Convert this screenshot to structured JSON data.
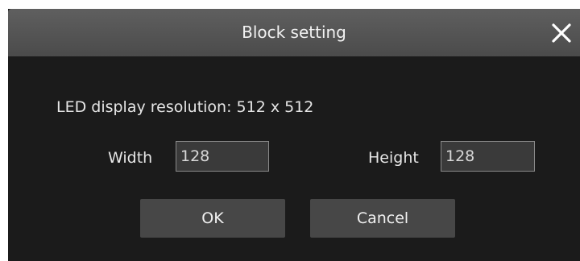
{
  "dialog": {
    "title": "Block setting",
    "close_icon": "close-icon",
    "resolution_text": "LED display resolution: 512 x 512",
    "width": {
      "label": "Width",
      "value": "128"
    },
    "height": {
      "label": "Height",
      "value": "128"
    },
    "ok_label": "OK",
    "cancel_label": "Cancel"
  },
  "colors": {
    "titlebar": "#555555",
    "body": "#1b1b1b",
    "input_bg": "#3a3a3a",
    "button_bg": "#474747",
    "text": "#e6e6e6"
  }
}
